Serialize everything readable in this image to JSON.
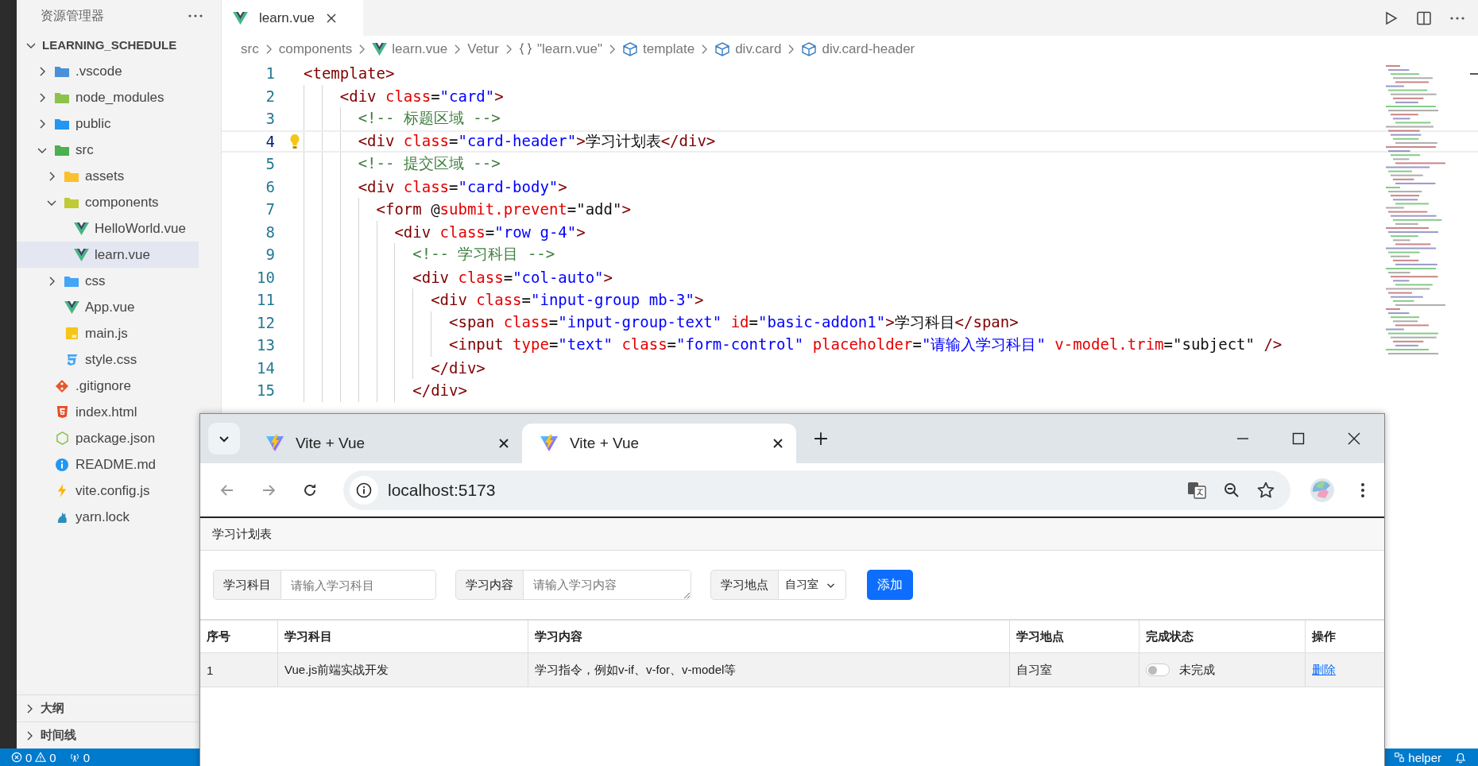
{
  "sidebar": {
    "title": "资源管理器",
    "tree": [
      {
        "label": "LEARNING_SCHEDULE",
        "kind": "root",
        "expanded": true,
        "selected": false,
        "children": [
          {
            "label": ".vscode",
            "kind": "folder-vscode",
            "expanded": false,
            "selected": false
          },
          {
            "label": "node_modules",
            "kind": "folder-node",
            "expanded": false,
            "selected": false
          },
          {
            "label": "public",
            "kind": "folder-public",
            "expanded": false,
            "selected": false
          },
          {
            "label": "src",
            "kind": "folder-src",
            "expanded": true,
            "selected": false,
            "children": [
              {
                "label": "assets",
                "kind": "folder-assets",
                "expanded": false,
                "selected": false
              },
              {
                "label": "components",
                "kind": "folder-components",
                "expanded": true,
                "selected": false,
                "children": [
                  {
                    "label": "HelloWorld.vue",
                    "kind": "vue",
                    "selected": false
                  },
                  {
                    "label": "learn.vue",
                    "kind": "vue",
                    "selected": true
                  }
                ]
              },
              {
                "label": "css",
                "kind": "folder-css",
                "expanded": false,
                "selected": false
              },
              {
                "label": "App.vue",
                "kind": "vue",
                "selected": false
              },
              {
                "label": "main.js",
                "kind": "js",
                "selected": false
              },
              {
                "label": "style.css",
                "kind": "css",
                "selected": false
              }
            ]
          },
          {
            "label": ".gitignore",
            "kind": "git",
            "selected": false
          },
          {
            "label": "index.html",
            "kind": "html",
            "selected": false
          },
          {
            "label": "package.json",
            "kind": "json",
            "selected": false
          },
          {
            "label": "README.md",
            "kind": "info",
            "selected": false
          },
          {
            "label": "vite.config.js",
            "kind": "vite",
            "selected": false
          },
          {
            "label": "yarn.lock",
            "kind": "yarn",
            "selected": false
          }
        ]
      }
    ],
    "sections": [
      {
        "label": "大纲",
        "expanded": false
      },
      {
        "label": "时间线",
        "expanded": false
      }
    ]
  },
  "editor": {
    "tab": {
      "title": "learn.vue"
    },
    "breadcrumbs": [
      {
        "label": "src",
        "kind": "plain"
      },
      {
        "label": "components",
        "kind": "plain"
      },
      {
        "label": "learn.vue",
        "kind": "vue"
      },
      {
        "label": "Vetur",
        "kind": "plain"
      },
      {
        "label": "\"learn.vue\"",
        "kind": "object"
      },
      {
        "label": "template",
        "kind": "element"
      },
      {
        "label": "div.card",
        "kind": "element"
      },
      {
        "label": "div.card-header",
        "kind": "element"
      }
    ],
    "lines": [
      {
        "number": "1",
        "current": false,
        "tokens": [
          {
            "kind": "tag",
            "text": "<template>"
          }
        ]
      },
      {
        "number": "2",
        "current": false,
        "tokens": [
          {
            "kind": "tag",
            "text": "    <div"
          },
          {
            "kind": "attr",
            "text": " class"
          },
          {
            "kind": "text",
            "text": "="
          },
          {
            "kind": "string",
            "text": "\"card\""
          },
          {
            "kind": "tag",
            "text": ">"
          }
        ]
      },
      {
        "number": "3",
        "current": false,
        "tokens": [
          {
            "kind": "comment",
            "text": "      <!-- 标题区域 -->"
          }
        ]
      },
      {
        "number": "4",
        "current": true,
        "tokens": [
          {
            "kind": "tag",
            "text": "      <div"
          },
          {
            "kind": "attr",
            "text": " class"
          },
          {
            "kind": "text",
            "text": "="
          },
          {
            "kind": "string",
            "text": "\"card-header\""
          },
          {
            "kind": "tag",
            "text": ">"
          },
          {
            "kind": "text",
            "text": "学习计划表"
          },
          {
            "kind": "tag",
            "text": "</div>"
          }
        ]
      },
      {
        "number": "5",
        "current": false,
        "tokens": [
          {
            "kind": "comment",
            "text": "      <!-- 提交区域 -->"
          }
        ]
      },
      {
        "number": "6",
        "current": false,
        "tokens": [
          {
            "kind": "tag",
            "text": "      <div"
          },
          {
            "kind": "attr",
            "text": " class"
          },
          {
            "kind": "text",
            "text": "="
          },
          {
            "kind": "string",
            "text": "\"card-body\""
          },
          {
            "kind": "tag",
            "text": ">"
          }
        ]
      },
      {
        "number": "7",
        "current": false,
        "tokens": [
          {
            "kind": "tag",
            "text": "        <form"
          },
          {
            "kind": "text",
            "text": " @"
          },
          {
            "kind": "attr",
            "text": "submit.prevent"
          },
          {
            "kind": "text",
            "text": "=\"add\""
          },
          {
            "kind": "tag",
            "text": ">"
          }
        ]
      },
      {
        "number": "8",
        "current": false,
        "tokens": [
          {
            "kind": "tag",
            "text": "          <div"
          },
          {
            "kind": "attr",
            "text": " class"
          },
          {
            "kind": "text",
            "text": "="
          },
          {
            "kind": "string",
            "text": "\"row g-4\""
          },
          {
            "kind": "tag",
            "text": ">"
          }
        ]
      },
      {
        "number": "9",
        "current": false,
        "tokens": [
          {
            "kind": "comment",
            "text": "            <!-- 学习科目 -->"
          }
        ]
      },
      {
        "number": "10",
        "current": false,
        "tokens": [
          {
            "kind": "tag",
            "text": "            <div"
          },
          {
            "kind": "attr",
            "text": " class"
          },
          {
            "kind": "text",
            "text": "="
          },
          {
            "kind": "string",
            "text": "\"col-auto\""
          },
          {
            "kind": "tag",
            "text": ">"
          }
        ]
      },
      {
        "number": "11",
        "current": false,
        "tokens": [
          {
            "kind": "tag",
            "text": "              <div"
          },
          {
            "kind": "attr",
            "text": " class"
          },
          {
            "kind": "text",
            "text": "="
          },
          {
            "kind": "string",
            "text": "\"input-group mb-3\""
          },
          {
            "kind": "tag",
            "text": ">"
          }
        ]
      },
      {
        "number": "12",
        "current": false,
        "tokens": [
          {
            "kind": "tag",
            "text": "                <span"
          },
          {
            "kind": "attr",
            "text": " class"
          },
          {
            "kind": "text",
            "text": "="
          },
          {
            "kind": "string",
            "text": "\"input-group-text\""
          },
          {
            "kind": "attr",
            "text": " id"
          },
          {
            "kind": "text",
            "text": "="
          },
          {
            "kind": "string",
            "text": "\"basic-addon1\""
          },
          {
            "kind": "tag",
            "text": ">"
          },
          {
            "kind": "text",
            "text": "学习科目"
          },
          {
            "kind": "tag",
            "text": "</span>"
          }
        ]
      },
      {
        "number": "13",
        "current": false,
        "tokens": [
          {
            "kind": "tag",
            "text": "                <input"
          },
          {
            "kind": "attr",
            "text": " type"
          },
          {
            "kind": "text",
            "text": "="
          },
          {
            "kind": "string",
            "text": "\"text\""
          },
          {
            "kind": "attr",
            "text": " class"
          },
          {
            "kind": "text",
            "text": "="
          },
          {
            "kind": "string",
            "text": "\"form-control\""
          },
          {
            "kind": "attr",
            "text": " placeholder"
          },
          {
            "kind": "text",
            "text": "="
          },
          {
            "kind": "string",
            "text": "\"请输入学习科目\""
          },
          {
            "kind": "attr",
            "text": " v-model.trim"
          },
          {
            "kind": "text",
            "text": "=\"subject\""
          },
          {
            "kind": "tag",
            "text": " />"
          }
        ]
      },
      {
        "number": "14",
        "current": false,
        "tokens": [
          {
            "kind": "tag",
            "text": "              </div>"
          }
        ]
      },
      {
        "number": "15",
        "current": false,
        "tokens": [
          {
            "kind": "tag",
            "text": "            </div>"
          }
        ]
      }
    ]
  },
  "browser": {
    "tabs": [
      {
        "title": "Vite + Vue",
        "selected": false
      },
      {
        "title": "Vite + Vue",
        "selected": true
      }
    ],
    "address": "localhost:5173",
    "page": {
      "header": "学习计划表",
      "form": [
        {
          "label": "学习科目",
          "kind": "input",
          "placeholder": "请输入学习科目"
        },
        {
          "label": "学习内容",
          "kind": "textarea",
          "placeholder": "请输入学习内容"
        },
        {
          "label": "学习地点",
          "kind": "select",
          "value": "自习室"
        }
      ],
      "button": "添加",
      "table": {
        "columns": [
          "序号",
          "学习科目",
          "学习内容",
          "学习地点",
          "完成状态",
          "操作"
        ],
        "rows": [
          {
            "index": "1",
            "subject": "Vue.js前端实战开发",
            "content": "学习指令，例如v-if、v-for、v-model等",
            "place": "自习室",
            "done": false,
            "status": "未完成",
            "action": "删除"
          }
        ]
      }
    }
  },
  "status_bar": {
    "errors": "0",
    "warnings": "0",
    "ports": "0",
    "remote": "helper"
  }
}
